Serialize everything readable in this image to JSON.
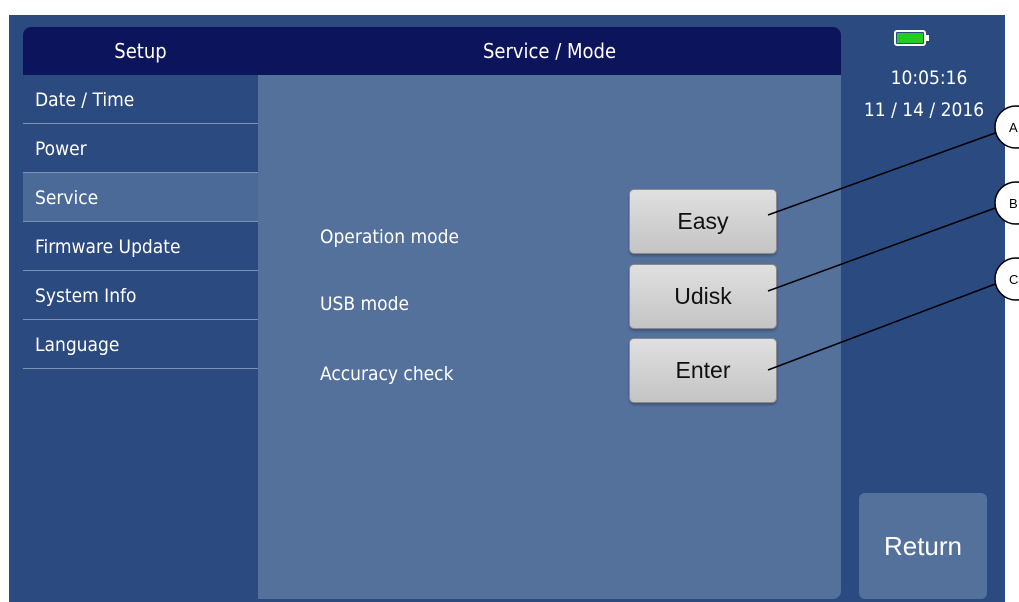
{
  "header": {
    "setup_label": "Setup",
    "title": "Service / Mode"
  },
  "sidebar": {
    "items": [
      {
        "label": "Date / Time",
        "active": false
      },
      {
        "label": "Power",
        "active": false
      },
      {
        "label": "Service",
        "active": true
      },
      {
        "label": "Firmware Update",
        "active": false
      },
      {
        "label": "System Info",
        "active": false
      },
      {
        "label": "Language",
        "active": false
      }
    ]
  },
  "main": {
    "rows": [
      {
        "label": "Operation mode",
        "button": "Easy"
      },
      {
        "label": "USB mode",
        "button": "Udisk"
      },
      {
        "label": "Accuracy check",
        "button": "Enter"
      }
    ]
  },
  "status": {
    "time": "10:05:16",
    "date": "11 / 14 / 2016",
    "battery_icon": "battery-full-icon",
    "battery_color": "#22cc22"
  },
  "return_label": "Return",
  "callouts": [
    "A",
    "B",
    "C"
  ],
  "colors": {
    "header": "#0c145c",
    "background": "#2a4a80",
    "panel": "#54719c",
    "button": "#d6d6d6"
  }
}
